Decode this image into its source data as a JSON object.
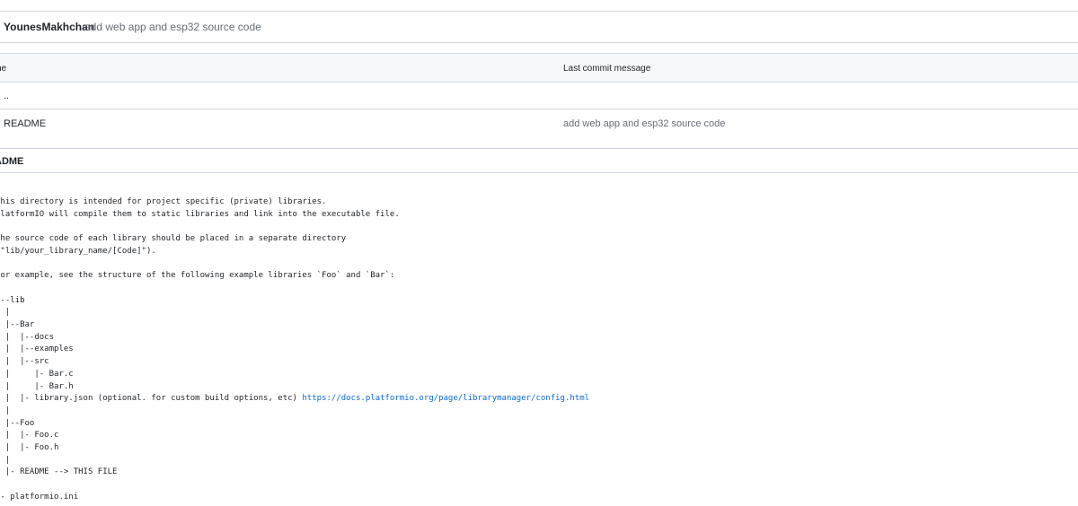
{
  "commit": {
    "author": "YounesMakhchan",
    "message": "add web app and esp32 source code"
  },
  "file_table": {
    "headers": {
      "name": "ne",
      "last_commit": "Last commit message"
    },
    "rows": [
      {
        "name": "..",
        "message": ""
      },
      {
        "name": "README",
        "message": "add web app and esp32 source code"
      }
    ]
  },
  "readme": {
    "title": "ADME",
    "text_before_link": "This directory is intended for project specific (private) libraries.\nPlatformIO will compile them to static libraries and link into the executable file.\n\nThe source code of each library should be placed in a separate directory\n(\"lib/your_library_name/[Code]\").\n\nFor example, see the structure of the following example libraries `Foo` and `Bar`:\n\n|--lib\n  |\n  |--Bar\n  |  |--docs\n  |  |--examples\n  |  |--src\n  |     |- Bar.c\n  |     |- Bar.h\n  |  |- library.json (optional. for custom build options, etc) ",
    "link_text": "https://docs.platformio.org/page/librarymanager/config.html",
    "text_after_link": "\n  |\n  |--Foo\n  |  |- Foo.c\n  |  |- Foo.h\n  |\n  |- README --> THIS FILE\n\n|- platformio.ini"
  }
}
